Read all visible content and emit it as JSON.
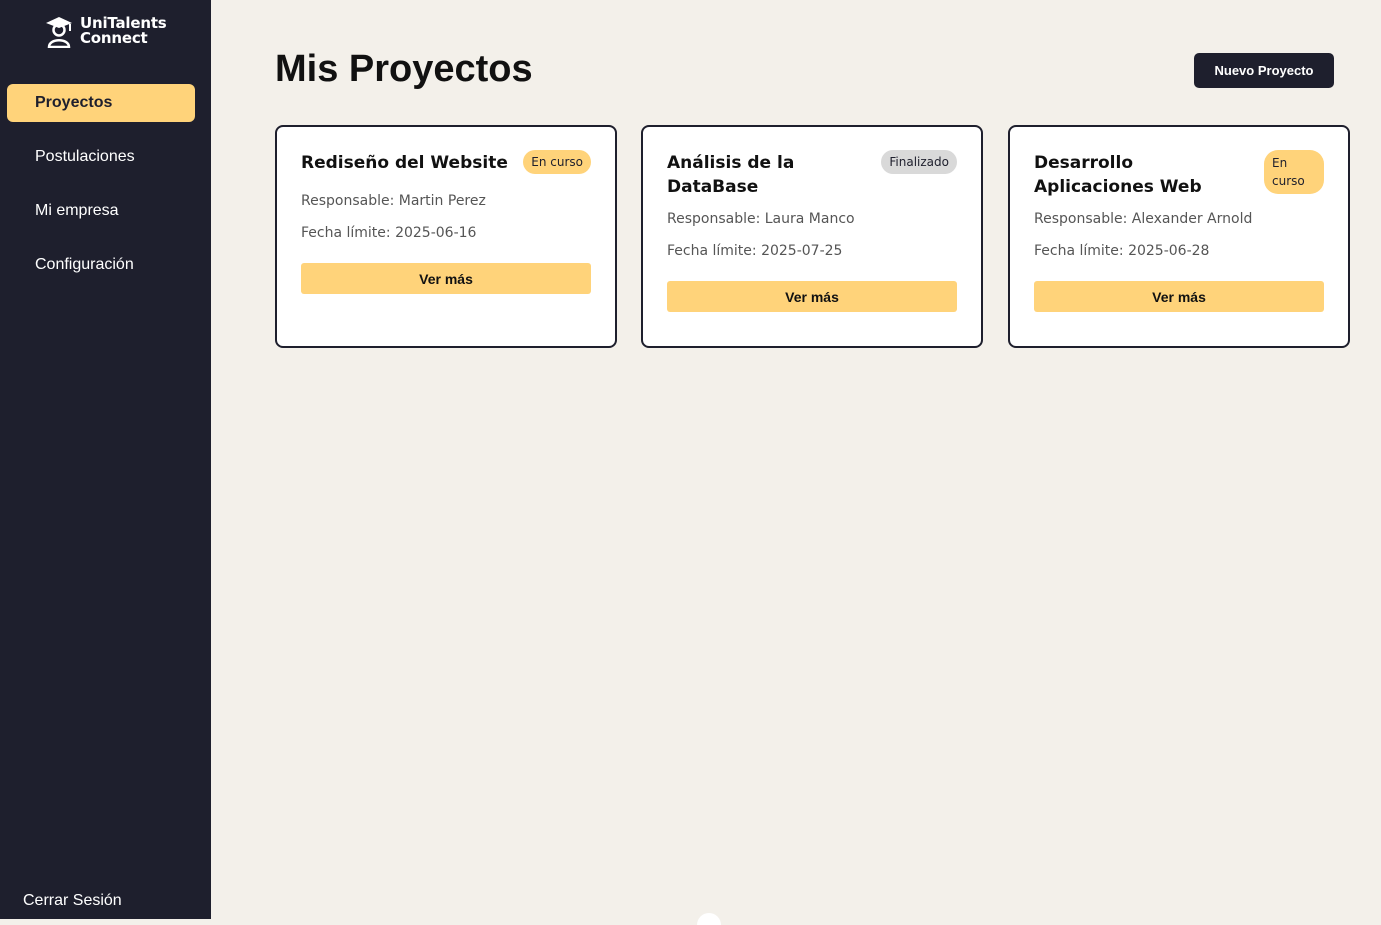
{
  "app": {
    "logo_line1": "UniTalents",
    "logo_line2": "Connect"
  },
  "sidebar": {
    "items": [
      {
        "label": "Proyectos",
        "active": true
      },
      {
        "label": "Postulaciones",
        "active": false
      },
      {
        "label": "Mi empresa",
        "active": false
      },
      {
        "label": "Configuración",
        "active": false
      }
    ],
    "logout_label": "Cerrar Sesión"
  },
  "main": {
    "title": "Mis Proyectos",
    "new_button_label": "Nuevo Proyecto",
    "projects": [
      {
        "title": "Rediseño del Website",
        "status": "En curso",
        "responsible": "Responsable: Martin Perez",
        "deadline": "Fecha límite: 2025-06-16",
        "button_label": "Ver más"
      },
      {
        "title": "Análisis de la DataBase",
        "status": "Finalizado",
        "responsible": "Responsable: Laura Manco",
        "deadline": "Fecha límite: 2025-07-25",
        "button_label": "Ver más"
      },
      {
        "title": "Desarrollo Aplicaciones Web",
        "status": "En curso",
        "responsible": "Responsable: Alexander Arnold",
        "deadline": "Fecha límite: 2025-06-28",
        "button_label": "Ver más"
      }
    ]
  },
  "colors": {
    "sidebar_bg": "#1e1f2d",
    "accent": "#ffd37a",
    "page_bg": "#f3f0ea",
    "badge_done": "#d9d9d9"
  },
  "icons": {
    "logo": "graduate-icon"
  }
}
